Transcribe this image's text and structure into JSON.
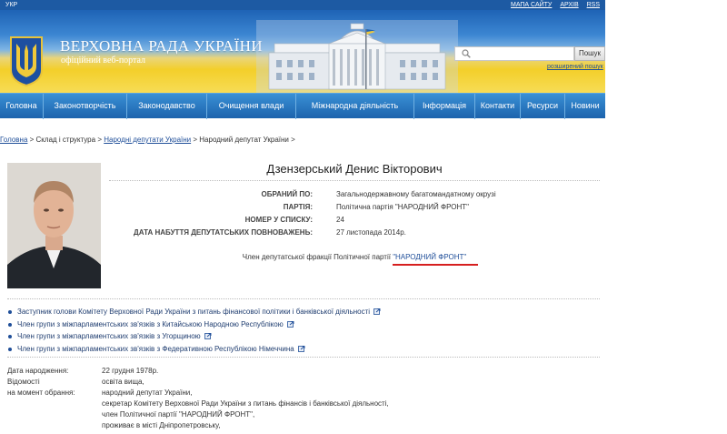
{
  "topbar": {
    "lang": "УКР",
    "links": [
      "МАПА САЙТУ",
      "АРХІВ",
      "RSS"
    ]
  },
  "header": {
    "title": "ВЕРХОВНА РАДА УКРАЇНИ",
    "subtitle": "офіційний веб-портал"
  },
  "search": {
    "placeholder": "",
    "button": "Пошук",
    "advanced": "розширений пошук"
  },
  "nav": [
    "Головна",
    "Законотворчість",
    "Законодавство",
    "Очищення влади",
    "Міжнародна діяльність",
    "Інформація",
    "Контакти",
    "Ресурси",
    "Новини"
  ],
  "breadcrumb": {
    "home": "Головна",
    "sep": " > ",
    "part2": "Склад і структура",
    "part3": "Народні депутати України",
    "part4": "Народний депутат України",
    "tail": " >"
  },
  "deputy": {
    "name": "Дзензерський Денис Вікторович",
    "fields": [
      {
        "label": "ОБРАНИЙ ПО:",
        "value": "Загальнодержавному багатомандатному окрузі"
      },
      {
        "label": "ПАРТІЯ:",
        "value": "Політична партія \"НАРОДНИЙ ФРОНТ\""
      },
      {
        "label": "НОМЕР У СПИСКУ:",
        "value": "24"
      },
      {
        "label": "ДАТА НАБУТТЯ ДЕПУТАТСЬКИХ ПОВНОВАЖЕНЬ:",
        "value": "27 листопада 2014р."
      }
    ],
    "faction_prefix": "Член депутатської фракції Політичної партії ",
    "faction_name": "\"НАРОДНИЙ ФРОНТ\"",
    "roles": [
      "Заступник голови Комітету Верховної Ради України з питань фінансової політики і банківської діяльності",
      "Член групи з міжпарламентських зв'язків з Китайською Народною Республікою",
      "Член групи з міжпарламентських зв'язків з Угорщиною",
      "Член групи з міжпарламентських зв'язків з Федеративною Республікою Німеччина"
    ],
    "bio": {
      "birth_label": "Дата народження:",
      "birth_value": "22 грудня 1978р.",
      "info_label1": "Відомості",
      "info_label2": "на момент обрання:",
      "lines": [
        "освіта вища,",
        "народний депутат України,",
        "секретар Комітету Верховної Ради України з питань фінансів і банківської діяльності,",
        "член Політичної партії \"НАРОДНИЙ ФРОНТ\",",
        "проживає в місті Дніпропетровську,"
      ]
    }
  },
  "colors": {
    "topbar": "#1d5aa3",
    "nav": "#2a78c4",
    "link": "#1f4e99",
    "underline": "#d61f1f"
  }
}
